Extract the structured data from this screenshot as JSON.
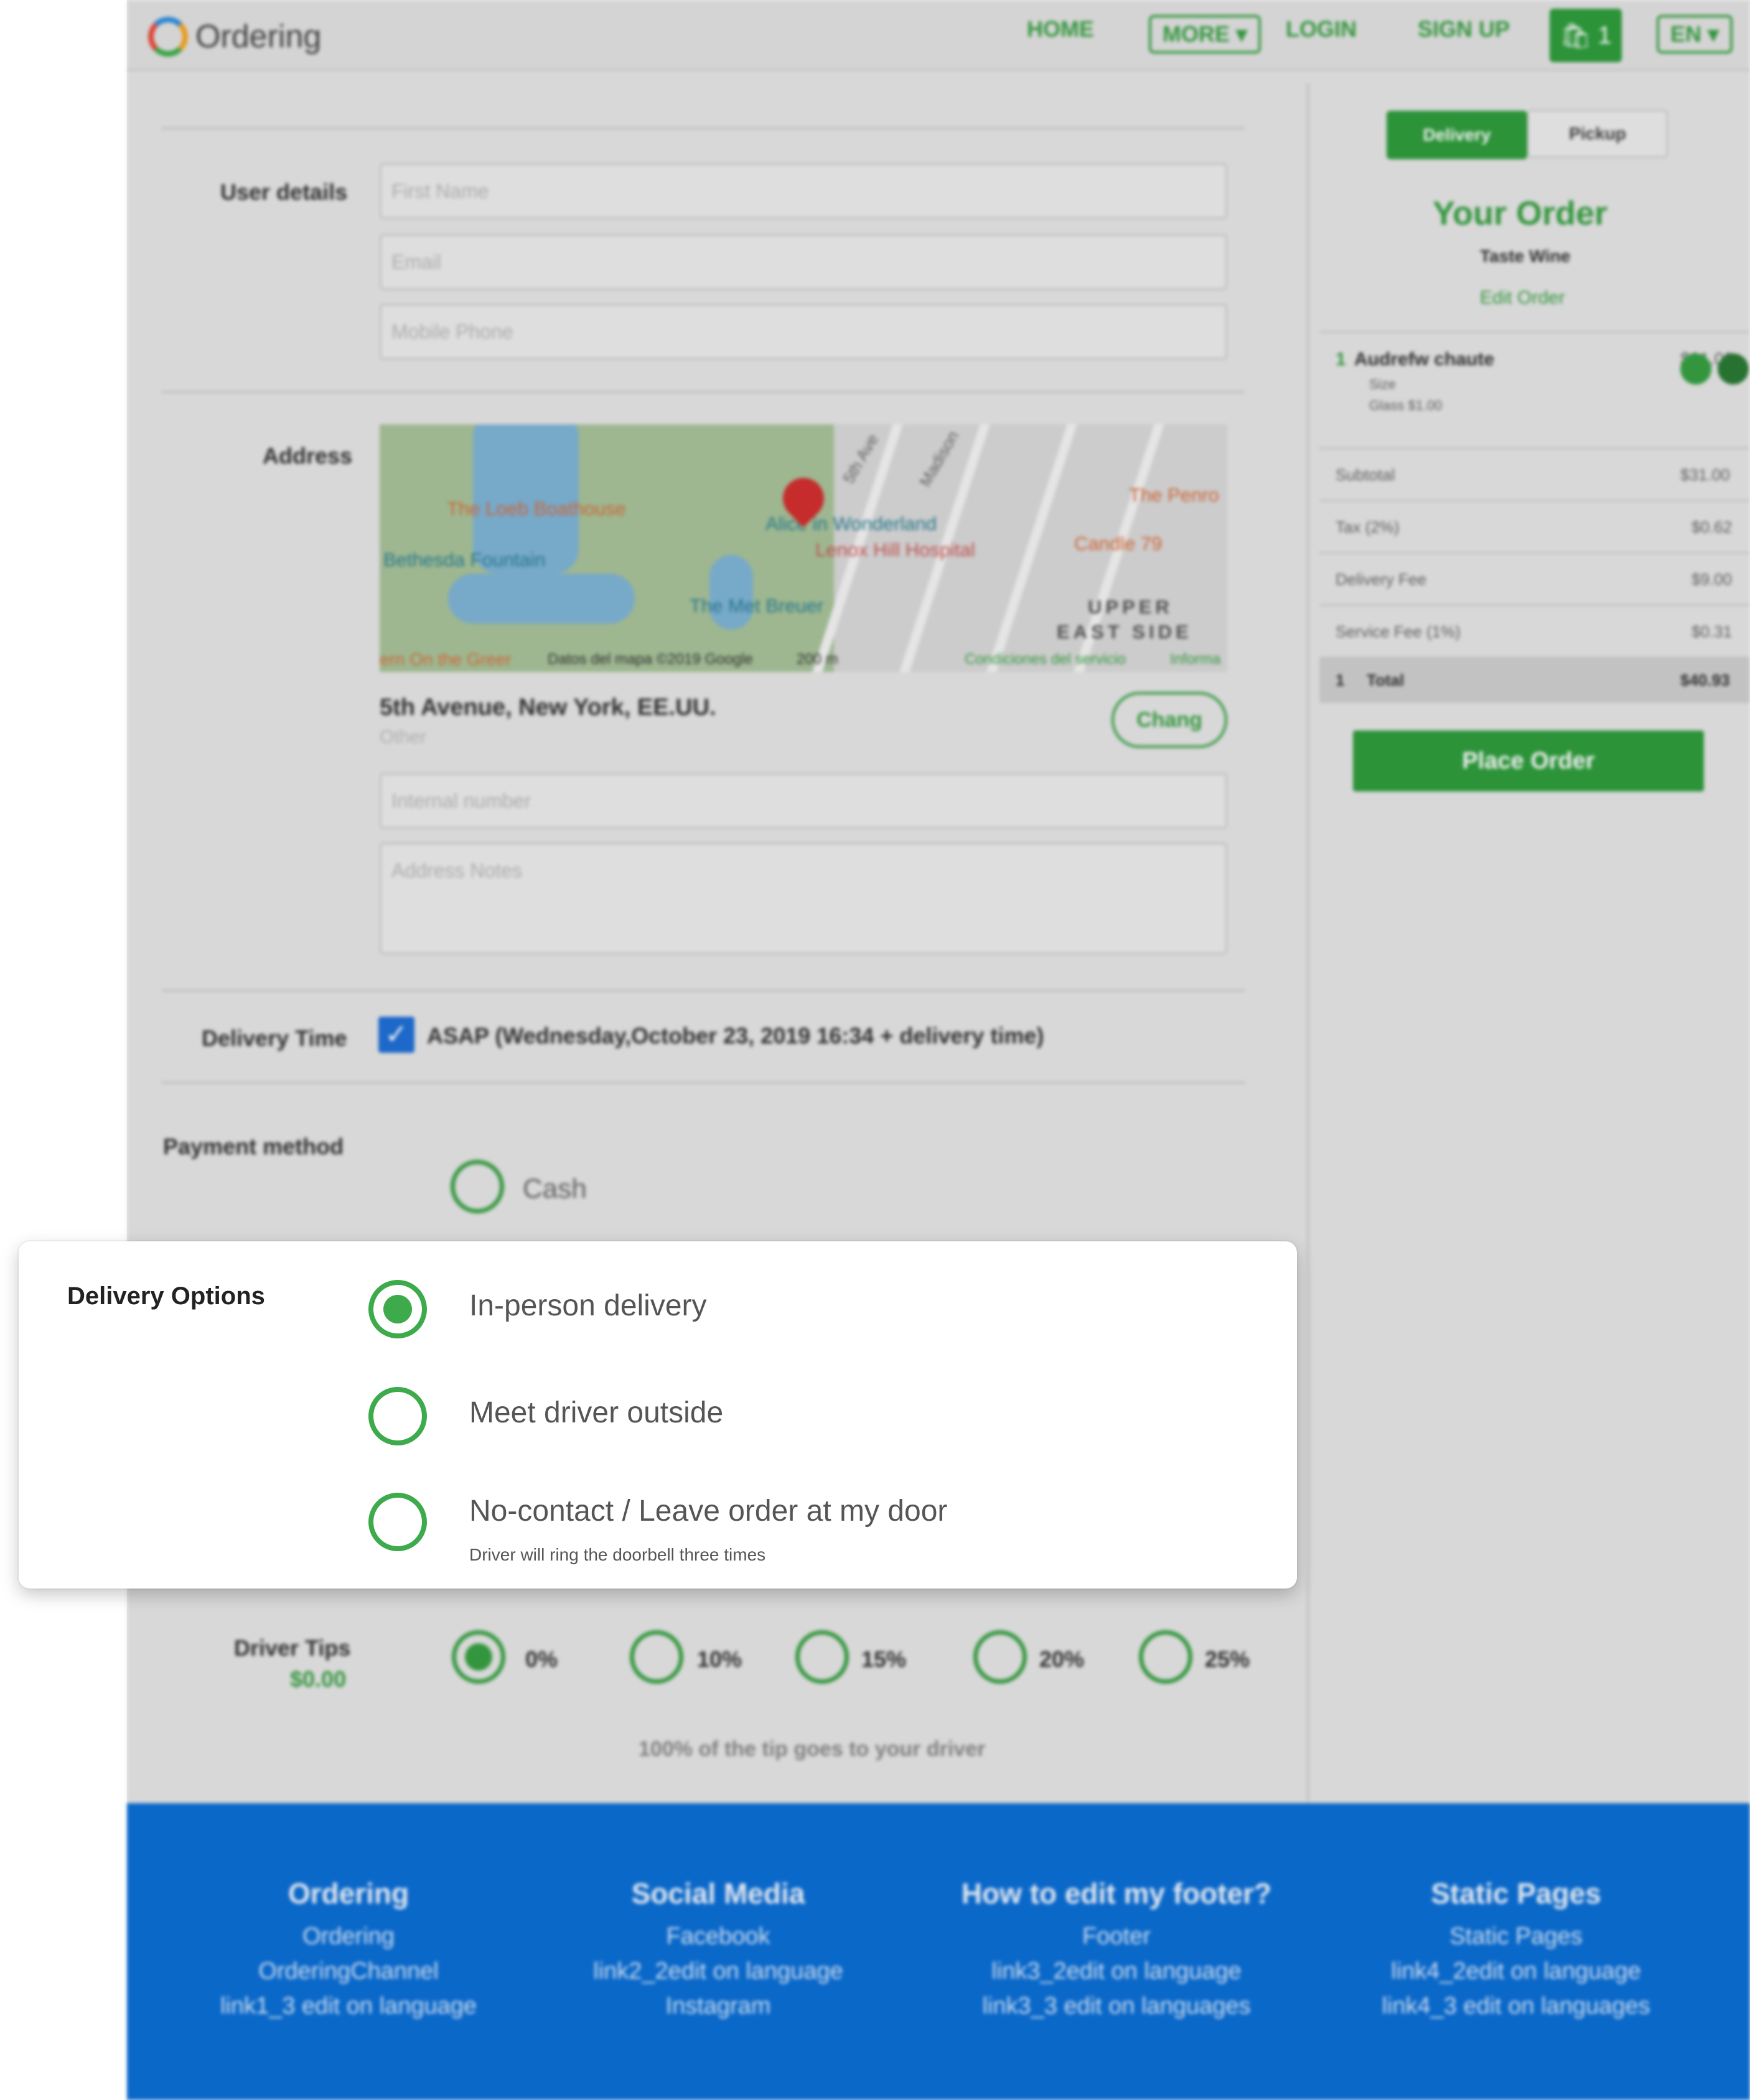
{
  "header": {
    "logo_text": "Ordering",
    "nav": {
      "home": "HOME",
      "more": "MORE ▾",
      "login": "LOGIN",
      "signup": "SIGN UP",
      "cart_count": "1",
      "language": "EN ▾"
    }
  },
  "form": {
    "user_details_label": "User details",
    "first_name_placeholder": "First Name",
    "email_placeholder": "Email",
    "phone_placeholder": "Mobile Phone",
    "address_label": "Address",
    "map_labels": [
      "The Loeb Boathouse",
      "Alice in Wonderland",
      "Lenox Hill Hospital",
      "Bethesda Fountain",
      "The Met Breuer",
      "Candle 79",
      "The Penro",
      "UPPER",
      "EAST SIDE",
      "5th Ave",
      "Madison",
      "Datos del mapa ©2019 Google",
      "200 m",
      "Condiciones del servicio",
      "Informa",
      "ern On the Greer"
    ],
    "address_line": "5th Avenue, New York, EE.UU.",
    "address_type": "Other",
    "change_label": "Chang",
    "internal_number_placeholder": "Internal number",
    "address_notes_placeholder": "Address Notes",
    "delivery_time_label": "Delivery Time",
    "delivery_time_value": "ASAP (Wednesday,October 23, 2019 16:34 + delivery time)",
    "payment_label": "Payment method",
    "payment_option": "Cash",
    "tips_label": "Driver Tips",
    "tips_amount": "$0.00",
    "tips_options": [
      "0%",
      "10%",
      "15%",
      "20%",
      "25%"
    ],
    "tips_note": "100% of the tip goes to your driver"
  },
  "sidebar": {
    "mode_delivery": "Delivery",
    "mode_pickup": "Pickup",
    "title": "Your Order",
    "store": "Taste Wine",
    "edit": "Edit Order",
    "item": {
      "qty": "1",
      "name": "Audrefw chaute",
      "price": "$31.00",
      "opt1": "Size",
      "opt2": "Glass $1.00"
    },
    "rows": [
      {
        "label": "Subtotal",
        "value": "$31.00"
      },
      {
        "label": "Tax (2%)",
        "value": "$0.62"
      },
      {
        "label": "Delivery Fee",
        "value": "$9.00"
      },
      {
        "label": "Service Fee (1%)",
        "value": "$0.31"
      }
    ],
    "total_qty": "1",
    "total_label": "Total",
    "total_value": "$40.93",
    "place_order": "Place Order"
  },
  "footer": {
    "columns": [
      {
        "heading": "Ordering",
        "links": [
          "Ordering",
          "OrderingChannel",
          "link1_3 edit on language"
        ]
      },
      {
        "heading": "Social Media",
        "links": [
          "Facebook",
          "link2_2edit on language",
          "Instagram"
        ]
      },
      {
        "heading": "How to edit my footer?",
        "links": [
          "Footer",
          "link3_2edit on language",
          "link3_3 edit on languages"
        ]
      },
      {
        "heading": "Static Pages",
        "links": [
          "Static Pages",
          "link4_2edit on language",
          "link4_3 edit on languages"
        ]
      }
    ]
  },
  "delivery_options": {
    "title": "Delivery Options",
    "options": [
      {
        "label": "In-person delivery",
        "selected": true,
        "note": ""
      },
      {
        "label": "Meet driver outside",
        "selected": false,
        "note": ""
      },
      {
        "label": "No-contact / Leave order at my door",
        "selected": false,
        "note": "Driver will ring the doorbell three times"
      }
    ]
  },
  "colors": {
    "accent": "#3daa4c",
    "footer": "#0b6fd6"
  }
}
